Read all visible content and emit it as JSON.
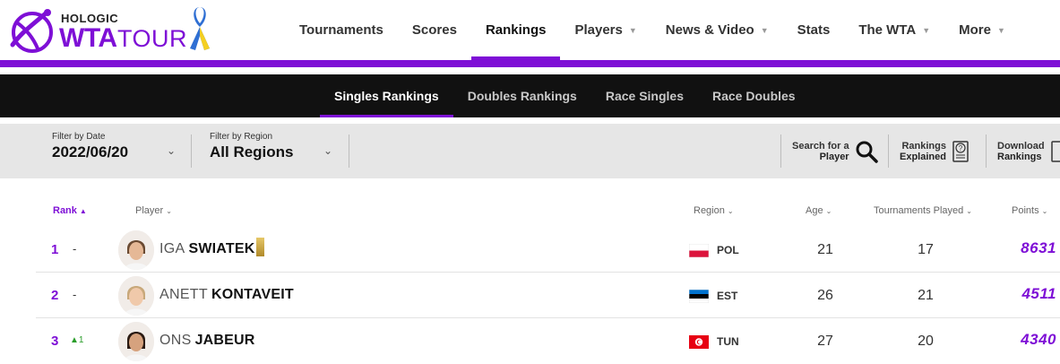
{
  "brand": {
    "sponsor": "HOLOGIC",
    "wta": "WTA",
    "tour": "TOUR",
    "accent": "#7e0fd6"
  },
  "nav": {
    "items": [
      {
        "label": "Tournaments",
        "dropdown": false
      },
      {
        "label": "Scores",
        "dropdown": false
      },
      {
        "label": "Rankings",
        "dropdown": false,
        "active": true
      },
      {
        "label": "Players",
        "dropdown": true
      },
      {
        "label": "News & Video",
        "dropdown": true
      },
      {
        "label": "Stats",
        "dropdown": false
      },
      {
        "label": "The WTA",
        "dropdown": true
      },
      {
        "label": "More",
        "dropdown": true
      }
    ]
  },
  "subnav": {
    "items": [
      {
        "label": "Singles Rankings",
        "active": true
      },
      {
        "label": "Doubles Rankings"
      },
      {
        "label": "Race Singles"
      },
      {
        "label": "Race Doubles"
      }
    ]
  },
  "filters": {
    "date": {
      "label": "Filter by Date",
      "value": "2022/06/20"
    },
    "region": {
      "label": "Filter by Region",
      "value": "All Regions"
    }
  },
  "tools": {
    "search": {
      "line1": "Search for a",
      "line2": "Player",
      "icon": "search-icon"
    },
    "explained": {
      "line1": "Rankings",
      "line2": "Explained",
      "icon": "help-document-icon"
    },
    "download": {
      "line1": "Download",
      "line2": "Rankings",
      "icon": "download-document-icon"
    }
  },
  "table": {
    "headers": {
      "rank": "Rank",
      "player": "Player",
      "region": "Region",
      "age": "Age",
      "tournaments": "Tournaments Played",
      "points": "Points"
    },
    "rows": [
      {
        "rank": "1",
        "move": "-",
        "first": "IGA",
        "last": "SWIATEK",
        "badge": true,
        "region": "POL",
        "age": "21",
        "tournaments": "17",
        "points": "8631"
      },
      {
        "rank": "2",
        "move": "-",
        "first": "ANETT",
        "last": "KONTAVEIT",
        "badge": false,
        "region": "EST",
        "age": "26",
        "tournaments": "21",
        "points": "4511"
      },
      {
        "rank": "3",
        "move": "▲1",
        "moveUp": true,
        "first": "ONS",
        "last": "JABEUR",
        "badge": false,
        "region": "TUN",
        "age": "27",
        "tournaments": "20",
        "points": "4340"
      }
    ]
  }
}
